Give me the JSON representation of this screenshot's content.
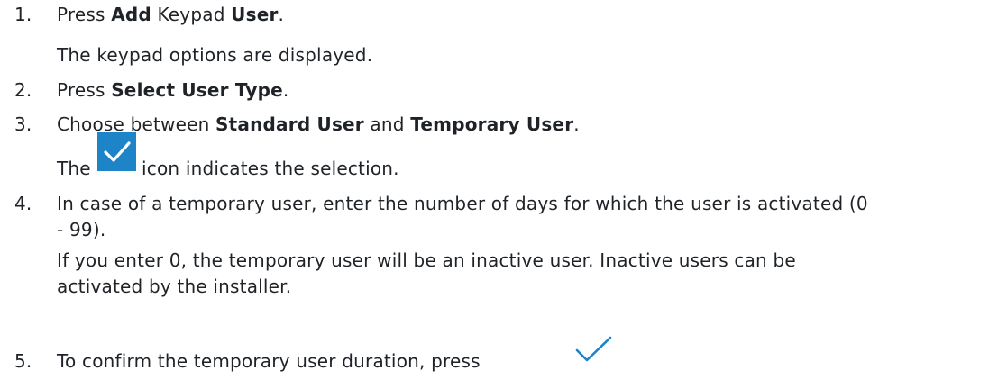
{
  "steps": [
    {
      "num": "1.",
      "parts": [
        "Press ",
        "Add",
        " Keypad ",
        "User",
        "."
      ],
      "result": "The keypad options are displayed."
    },
    {
      "num": "2.",
      "parts": [
        "Press ",
        "Select User Type",
        "."
      ]
    },
    {
      "num": "3.",
      "parts": [
        "Choose between ",
        "Standard User",
        " and ",
        "Temporary User",
        "."
      ],
      "result_before_icon": "The",
      "result_after_icon": "icon indicates the selection."
    },
    {
      "num": "4.",
      "lines": [
        "In case of a temporary user, enter the number of days for which the user is activated (0",
        "- 99)."
      ],
      "result_lines": [
        "If you enter 0, the temporary user will be an inactive user. Inactive users can be",
        "activated by the installer."
      ]
    },
    {
      "num": "5.",
      "text": "To confirm the temporary user duration, press"
    }
  ],
  "icons": {
    "selection_icon": "checkmark-box-icon",
    "confirm_icon": "checkmark-icon",
    "accent": "#1d84c8",
    "check_color": "#ffffff"
  }
}
